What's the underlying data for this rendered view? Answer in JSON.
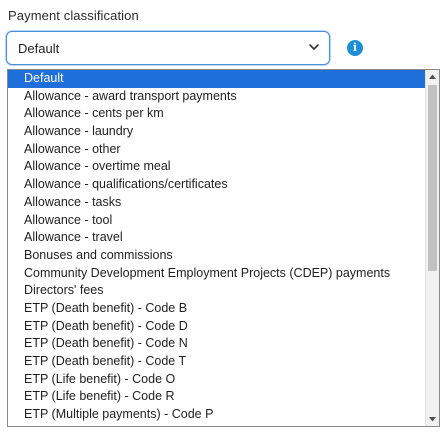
{
  "field": {
    "label": "Payment classification",
    "selected_value": "Default"
  },
  "icons": {
    "chevron": "chevron-down-icon",
    "info": "info-icon"
  },
  "colors": {
    "focus_border": "#4a90d9",
    "selected_option_bg": "#1e6fd9",
    "info_icon": "#1d8fd6"
  },
  "options": [
    {
      "label": "Default",
      "selected": true
    },
    {
      "label": "Allowance - award transport payments"
    },
    {
      "label": "Allowance - cents per km"
    },
    {
      "label": "Allowance - laundry"
    },
    {
      "label": "Allowance - other"
    },
    {
      "label": "Allowance - overtime meal"
    },
    {
      "label": "Allowance - qualifications/certificates"
    },
    {
      "label": "Allowance - tasks"
    },
    {
      "label": "Allowance - tool"
    },
    {
      "label": "Allowance - travel"
    },
    {
      "label": "Bonuses and commissions"
    },
    {
      "label": "Community Development Employment Projects (CDEP) payments"
    },
    {
      "label": "Directors' fees"
    },
    {
      "label": "ETP (Death benefit) - Code B"
    },
    {
      "label": "ETP (Death benefit) - Code D"
    },
    {
      "label": "ETP (Death benefit) - Code N"
    },
    {
      "label": "ETP (Death benefit) - Code T"
    },
    {
      "label": "ETP (Life benefit) - Code O"
    },
    {
      "label": "ETP (Life benefit) - Code R"
    },
    {
      "label": "ETP (Multiple payments) - Code P"
    }
  ]
}
